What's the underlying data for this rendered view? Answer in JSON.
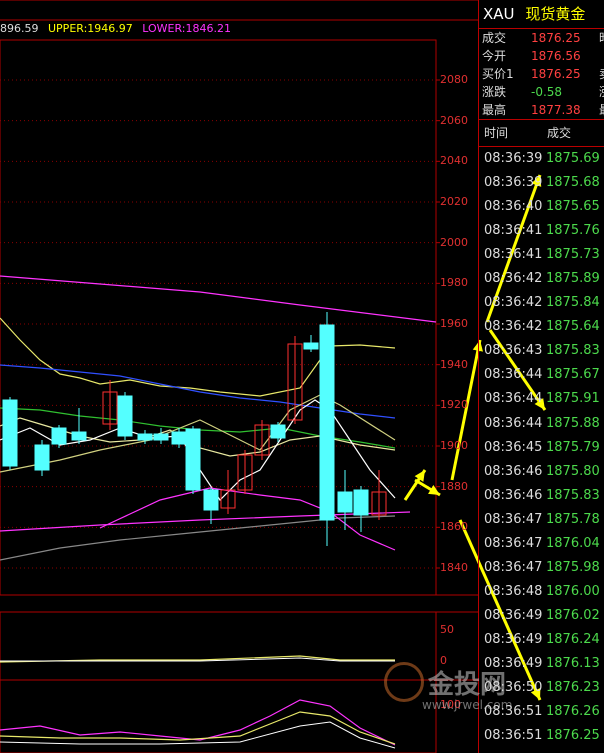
{
  "indicator_header": {
    "partial_value": "896.59",
    "upper_label": "UPPER:1946.97",
    "lower_label": "LOWER:1846.21",
    "upper_color": "#ffff00",
    "lower_color": "#ff33ff"
  },
  "price_axis": [
    "2080",
    "2060",
    "2040",
    "2020",
    "2000",
    "1980",
    "1960",
    "1940",
    "1920",
    "1900",
    "1880",
    "1860",
    "1840"
  ],
  "sub1_axis": [
    "50",
    "0"
  ],
  "sub2_axis": [
    "100"
  ],
  "panel": {
    "symbol": "XAU",
    "name": "现货黄金",
    "quotes": [
      {
        "label": "成交",
        "value": "1876.25",
        "color": "#ff4040",
        "extra": "昨"
      },
      {
        "label": "今开",
        "value": "1876.56",
        "color": "#ff4040",
        "extra": ""
      },
      {
        "label": "买价1",
        "value": "1876.25",
        "color": "#ff4040",
        "extra": "卖"
      },
      {
        "label": "涨跌",
        "value": "-0.58",
        "color": "#4cd94c",
        "extra": "涨"
      },
      {
        "label": "最高",
        "value": "1877.38",
        "color": "#ff4040",
        "extra": "最"
      }
    ],
    "tick_headers": {
      "time": "时间",
      "price": "成交"
    },
    "ticks": [
      {
        "time": "08:36:39",
        "price": "1875.69"
      },
      {
        "time": "08:36:39",
        "price": "1875.68"
      },
      {
        "time": "08:36:40",
        "price": "1875.65"
      },
      {
        "time": "08:36:41",
        "price": "1875.76"
      },
      {
        "time": "08:36:41",
        "price": "1875.73"
      },
      {
        "time": "08:36:42",
        "price": "1875.89"
      },
      {
        "time": "08:36:42",
        "price": "1875.84"
      },
      {
        "time": "08:36:42",
        "price": "1875.64"
      },
      {
        "time": "08:36:43",
        "price": "1875.83"
      },
      {
        "time": "08:36:44",
        "price": "1875.67"
      },
      {
        "time": "08:36:44",
        "price": "1875.91"
      },
      {
        "time": "08:36:44",
        "price": "1875.88"
      },
      {
        "time": "08:36:45",
        "price": "1875.79"
      },
      {
        "time": "08:36:46",
        "price": "1875.80"
      },
      {
        "time": "08:36:46",
        "price": "1875.83"
      },
      {
        "time": "08:36:47",
        "price": "1875.78"
      },
      {
        "time": "08:36:47",
        "price": "1876.04"
      },
      {
        "time": "08:36:47",
        "price": "1875.98"
      },
      {
        "time": "08:36:48",
        "price": "1876.00"
      },
      {
        "time": "08:36:49",
        "price": "1876.02"
      },
      {
        "time": "08:36:49",
        "price": "1876.24"
      },
      {
        "time": "08:36:49",
        "price": "1876.13"
      },
      {
        "time": "08:36:50",
        "price": "1876.23"
      },
      {
        "time": "08:36:51",
        "price": "1876.26"
      },
      {
        "time": "08:36:51",
        "price": "1876.25"
      }
    ]
  },
  "watermark": {
    "text": "金投网",
    "url": "www.jrwel.com"
  },
  "colors": {
    "up": "#ff3030",
    "down": "#54ffff",
    "grid": "#b00000",
    "accent": "#ffff00"
  }
}
